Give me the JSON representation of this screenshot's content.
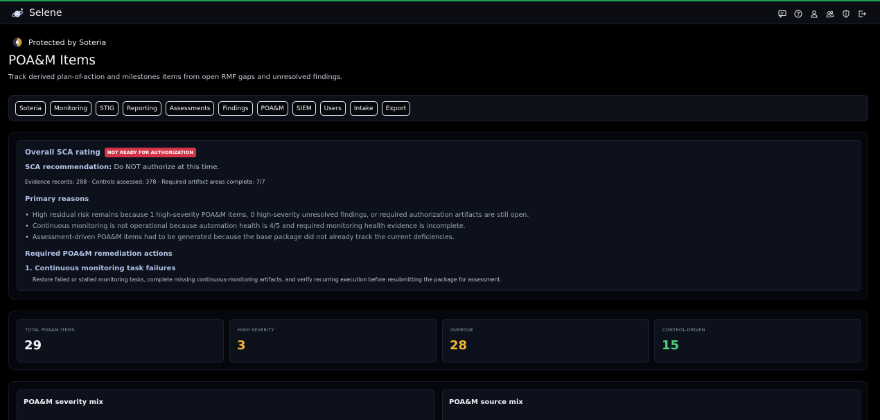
{
  "app": {
    "name": "Selene"
  },
  "header_icons": [
    "chat-icon",
    "help-icon",
    "user-icon",
    "users-icon",
    "shield-icon",
    "logout-icon"
  ],
  "page": {
    "protected_label": "Protected by Soteria",
    "title": "POA&M Items",
    "subtitle": "Track derived plan-of-action and milestones items from open RMF gaps and unresolved findings."
  },
  "nav": [
    {
      "label": "Soteria"
    },
    {
      "label": "Monitoring"
    },
    {
      "label": "STIG"
    },
    {
      "label": "Reporting"
    },
    {
      "label": "Assessments"
    },
    {
      "label": "Findings"
    },
    {
      "label": "POA&M"
    },
    {
      "label": "SIEM"
    },
    {
      "label": "Users"
    },
    {
      "label": "Intake"
    },
    {
      "label": "Export"
    }
  ],
  "sca": {
    "label": "Overall SCA rating",
    "badge": "NOT READY FOR AUTHORIZATION",
    "badge_color": "#d23548",
    "recommendation_label": "SCA recommendation:",
    "recommendation_text": "Do NOT authorize at this time.",
    "evidence": "Evidence records: 288 · Controls assessed: 378 · Required artifact areas complete: 7/7",
    "reasons_heading": "Primary reasons",
    "reasons": [
      "High residual risk remains because 1 high-severity POA&M items, 0 high-severity unresolved findings, or required authorization artifacts are still open.",
      "Continuous monitoring is not operational because automation health is 4/5 and required monitoring health evidence is incomplete.",
      "Assessment-driven POA&M items had to be generated because the base package did not already track the current deficiencies."
    ],
    "actions_heading": "Required POA&M remediation actions",
    "actions": [
      {
        "title": "1. Continuous monitoring task failures",
        "description": "Restore failed or stalled monitoring tasks, complete missing continuous-monitoring artifacts, and verify recurring execution before resubmitting the package for assessment."
      }
    ]
  },
  "metrics": [
    {
      "label": "TOTAL POA&M ITEMS",
      "value": "29",
      "color": "#f2f4f8"
    },
    {
      "label": "HIGH SEVERITY",
      "value": "3",
      "color": "#f4b731"
    },
    {
      "label": "OVERDUE",
      "value": "28",
      "color": "#f4b731"
    },
    {
      "label": "CONTROL-DRIVEN",
      "value": "15",
      "color": "#4bd27a"
    }
  ],
  "mix": [
    {
      "title": "POA&M severity mix"
    },
    {
      "title": "POA&M source mix"
    }
  ]
}
